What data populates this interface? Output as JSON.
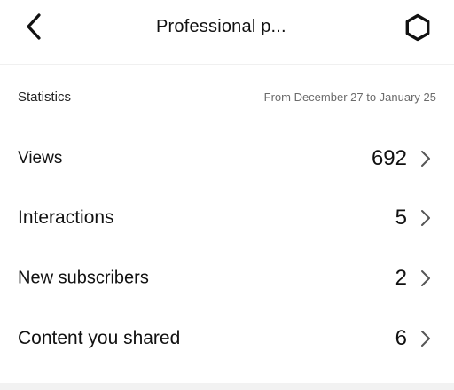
{
  "header": {
    "title": "Professional p...",
    "back_icon": "chevron-left-icon",
    "settings_icon": "gear-icon"
  },
  "statistics": {
    "label": "Statistics",
    "date_range": "From December 27 to January 25"
  },
  "rows": [
    {
      "label": "Views",
      "value": "692"
    },
    {
      "label": "Interactions",
      "value": "5"
    },
    {
      "label": "New subscribers",
      "value": "2"
    },
    {
      "label": "Content you shared",
      "value": "6"
    }
  ],
  "colors": {
    "text": "#111111",
    "secondary_text": "#6b6b6b",
    "chevron": "#555555",
    "divider": "#f0f0f0"
  }
}
